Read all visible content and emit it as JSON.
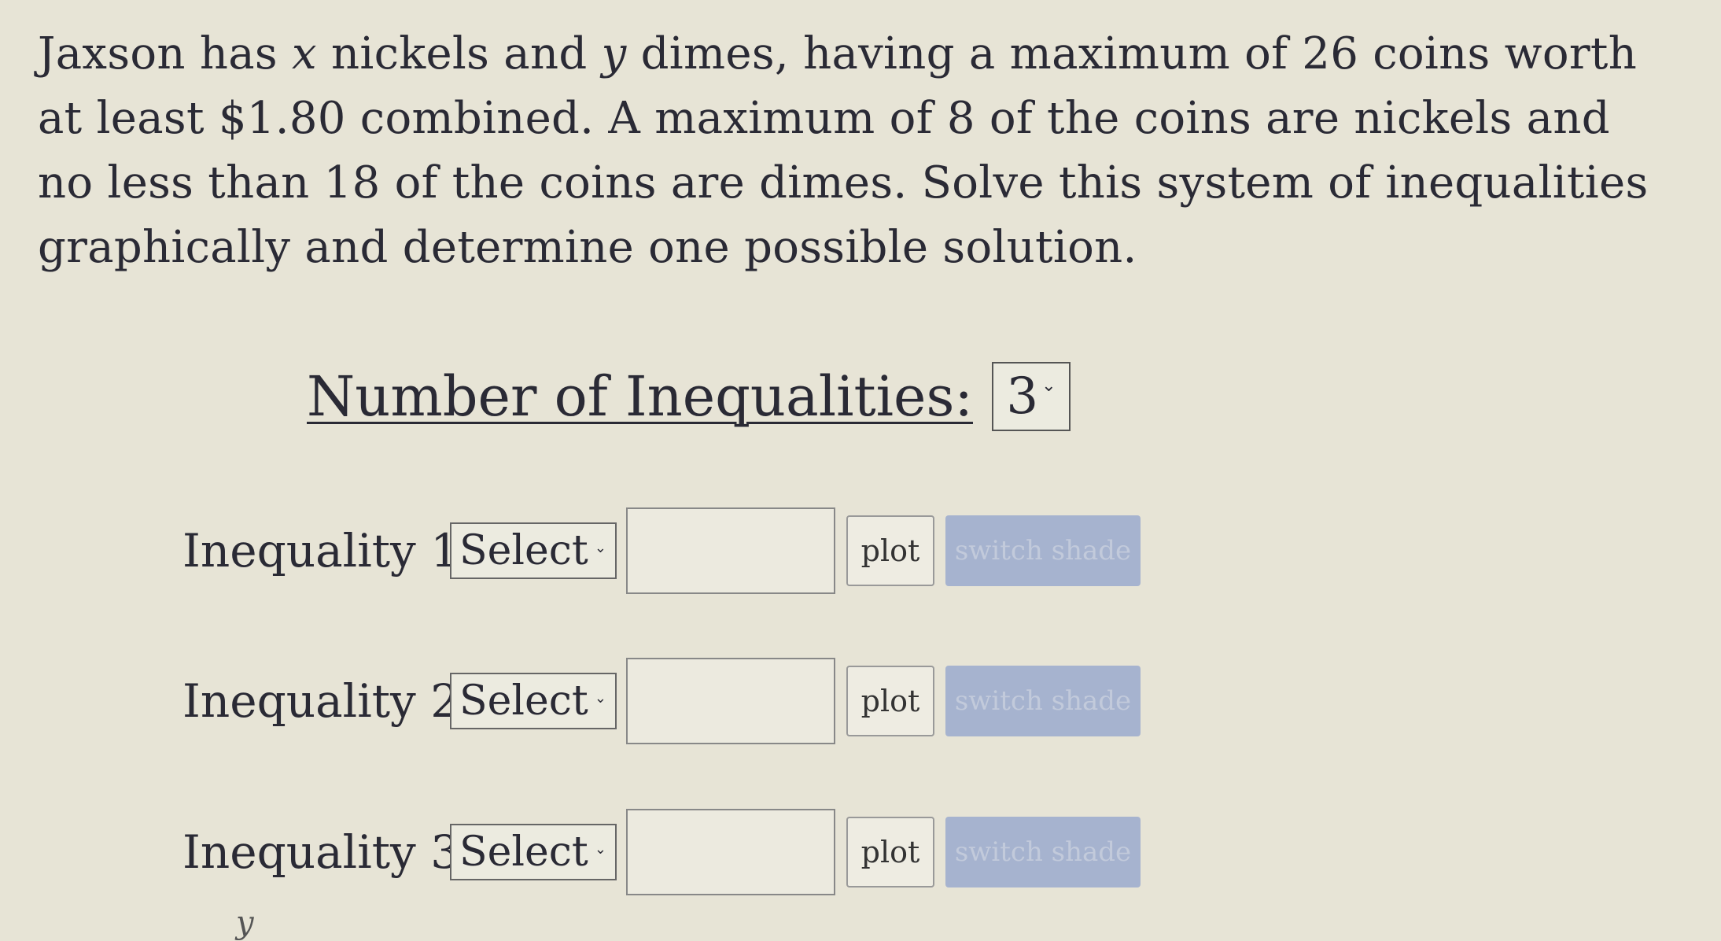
{
  "question": {
    "p1": "Jaxson has ",
    "var_x": "x",
    "p2": " nickels and ",
    "var_y": "y",
    "p3": " dimes, having a maximum of 26 coins worth at least $1.80 combined. A maximum of 8 of the coins are nickels and no less than 18 of the coins are dimes. Solve this system of inequalities graphically and determine one possible solution."
  },
  "num_inequalities": {
    "label": "Number of Inequalities:",
    "value": "3"
  },
  "inequalities": [
    {
      "label": "Inequality 1:",
      "select": "Select",
      "input_value": "",
      "plot": "plot",
      "switch_shade": "switch shade"
    },
    {
      "label": "Inequality 2:",
      "select": "Select",
      "input_value": "",
      "plot": "plot",
      "switch_shade": "switch shade"
    },
    {
      "label": "Inequality 3:",
      "select": "Select",
      "input_value": "",
      "plot": "plot",
      "switch_shade": "switch shade"
    }
  ],
  "graph": {
    "y_axis_label": "y"
  },
  "icons": {
    "dropdown": "chevron-down-icon"
  }
}
